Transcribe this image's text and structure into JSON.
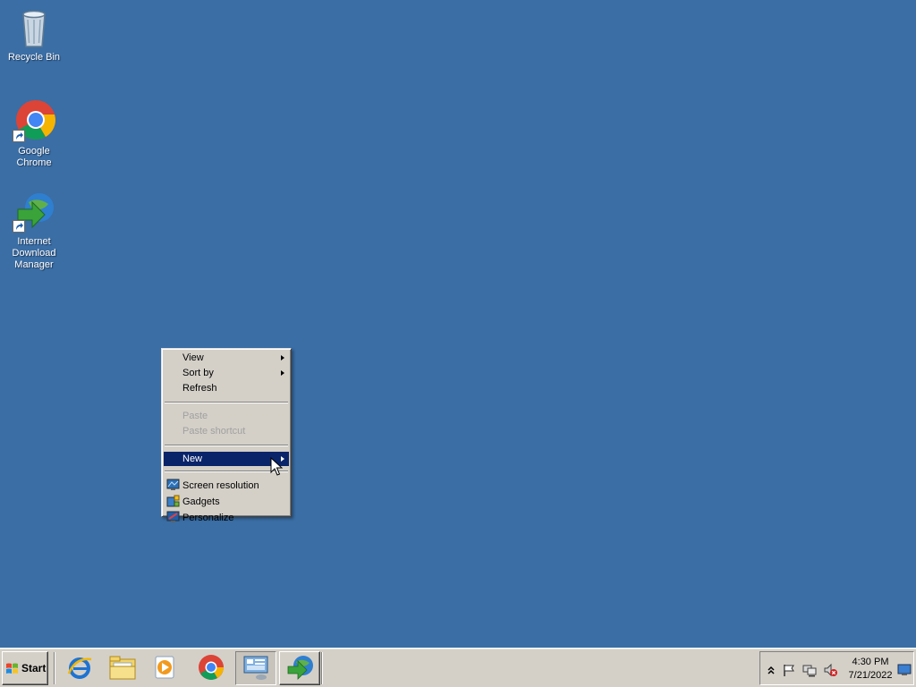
{
  "desktop": {
    "background_color": "#3a6ea5",
    "icons": [
      {
        "label": "Recycle Bin",
        "icon": "recycle-bin-icon"
      },
      {
        "label": "Google Chrome",
        "icon": "chrome-icon"
      },
      {
        "label": "Internet Download Manager",
        "icon": "idm-icon"
      }
    ]
  },
  "context_menu": {
    "items": [
      {
        "label": "View",
        "submenu": true,
        "enabled": true
      },
      {
        "label": "Sort by",
        "submenu": true,
        "enabled": true
      },
      {
        "label": "Refresh",
        "submenu": false,
        "enabled": true
      },
      {
        "label": "Paste",
        "submenu": false,
        "enabled": false
      },
      {
        "label": "Paste shortcut",
        "submenu": false,
        "enabled": false
      },
      {
        "label": "New",
        "submenu": true,
        "enabled": true,
        "highlighted": true
      },
      {
        "label": "Screen resolution",
        "icon": "screen-resolution-icon",
        "enabled": true
      },
      {
        "label": "Gadgets",
        "icon": "gadgets-icon",
        "enabled": true
      },
      {
        "label": "Personalize",
        "icon": "personalize-icon",
        "enabled": true
      }
    ],
    "highlight_color": "#0a246a"
  },
  "taskbar": {
    "start_label": "Start",
    "pinned": [
      {
        "icon": "internet-explorer-icon"
      },
      {
        "icon": "file-explorer-icon"
      },
      {
        "icon": "media-player-icon"
      },
      {
        "icon": "chrome-icon"
      },
      {
        "icon": "server-manager-icon"
      },
      {
        "icon": "idm-icon"
      }
    ]
  },
  "tray": {
    "icons": [
      "show-hidden-icons-icon",
      "action-center-flag-icon",
      "network-icon",
      "volume-muted-icon"
    ],
    "time": "4:30 PM",
    "date": "7/21/2022"
  }
}
